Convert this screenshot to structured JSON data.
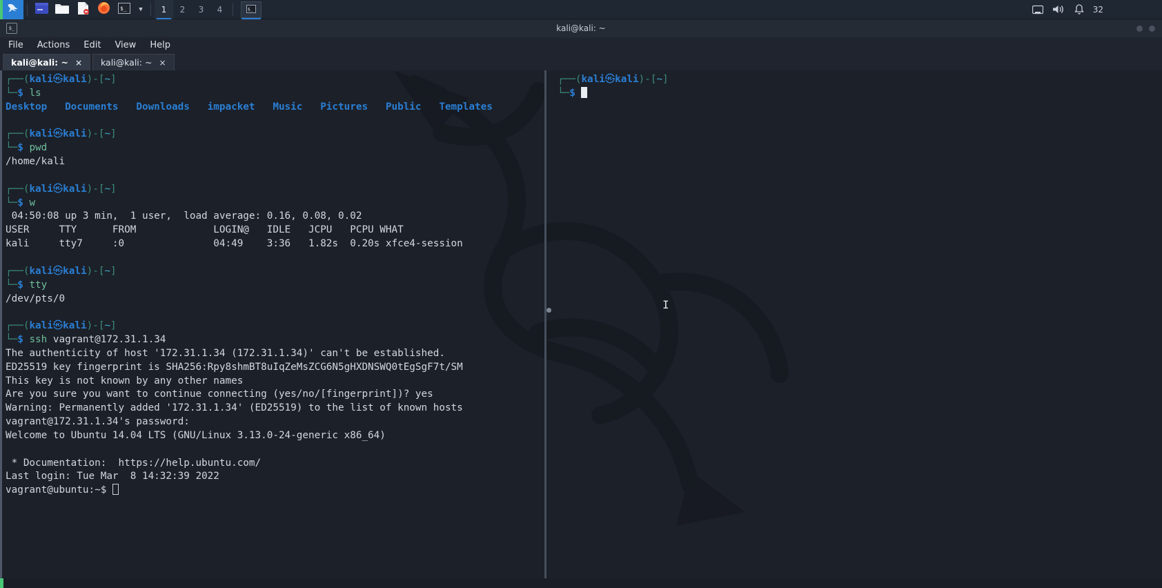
{
  "taskbar": {
    "kali_logo_icon": "kali-dragon-icon",
    "launchers": [
      {
        "name": "terminal-emulator-launcher",
        "icon": "terminal-window-icon"
      },
      {
        "name": "file-manager-launcher",
        "icon": "folder-icon"
      },
      {
        "name": "text-editor-launcher",
        "icon": "document-icon"
      },
      {
        "name": "firefox-launcher",
        "icon": "firefox-icon"
      },
      {
        "name": "terminal-launcher",
        "icon": "terminal-prompt-icon"
      }
    ],
    "chevron_icon": "chevron-down-icon",
    "workspaces": [
      {
        "label": "1",
        "active": true
      },
      {
        "label": "2",
        "active": false
      },
      {
        "label": "3",
        "active": false
      },
      {
        "label": "4",
        "active": false
      }
    ],
    "window_button_icon": "terminal-prompt-icon",
    "tray": [
      {
        "name": "network-icon",
        "glyph": "▣"
      },
      {
        "name": "volume-icon",
        "glyph": "🔊"
      },
      {
        "name": "notification-bell-icon",
        "glyph": "🔔"
      }
    ],
    "clock": "32"
  },
  "window": {
    "title": "kali@kali: ~",
    "icon": "terminal-window-icon",
    "menu": [
      "File",
      "Actions",
      "Edit",
      "View",
      "Help"
    ],
    "tabs": [
      {
        "label": "kali@kali: ~",
        "close": "×",
        "active": true
      },
      {
        "label": "kali@kali: ~",
        "close": "×",
        "active": false
      }
    ]
  },
  "terminal": {
    "prompt": {
      "top_left": "┌──(",
      "user": "kali",
      "at": "㉿",
      "host": "kali",
      "close_paren": ")-[",
      "path": "~",
      "close_bracket": "]",
      "bottom_left": "└─",
      "dollar": "$"
    },
    "left_pane": {
      "blocks": [
        {
          "command": "ls",
          "output": [
            {
              "text": "Desktop   Documents   Downloads   impacket   Music   Pictures   Public   Templates",
              "class": "c-dir"
            }
          ]
        },
        {
          "command": "pwd",
          "output": [
            {
              "text": "/home/kali",
              "class": "c-out"
            }
          ]
        },
        {
          "command": "w",
          "output": [
            {
              "text": " 04:50:08 up 3 min,  1 user,  load average: 0.16, 0.08, 0.02",
              "class": "c-out"
            },
            {
              "text": "USER     TTY      FROM             LOGIN@   IDLE   JCPU   PCPU WHAT",
              "class": "c-out"
            },
            {
              "text": "kali     tty7     :0               04:49    3:36   1.82s  0.20s xfce4-session",
              "class": "c-out"
            }
          ]
        },
        {
          "command": "tty",
          "output": [
            {
              "text": "/dev/pts/0",
              "class": "c-out"
            }
          ]
        },
        {
          "command": "ssh",
          "command_arg": " vagrant@172.31.1.34",
          "output": [
            {
              "text": "The authenticity of host '172.31.1.34 (172.31.1.34)' can't be established.",
              "class": "c-out"
            },
            {
              "text": "ED25519 key fingerprint is SHA256:Rpy8shmBT8uIqZeMsZCG6N5gHXDNSWQ0tEgSgF7t/SM",
              "class": "c-out"
            },
            {
              "text": "This key is not known by any other names",
              "class": "c-out"
            },
            {
              "text": "Are you sure you want to continue connecting (yes/no/[fingerprint])? yes",
              "class": "c-out"
            },
            {
              "text": "Warning: Permanently added '172.31.1.34' (ED25519) to the list of known hosts",
              "class": "c-out"
            },
            {
              "text": "vagrant@172.31.1.34's password:",
              "class": "c-out"
            },
            {
              "text": "Welcome to Ubuntu 14.04 LTS (GNU/Linux 3.13.0-24-generic x86_64)",
              "class": "c-out"
            },
            {
              "text": "",
              "class": "c-out"
            },
            {
              "text": " * Documentation:  https://help.ubuntu.com/",
              "class": "c-out"
            },
            {
              "text": "Last login: Tue Mar  8 14:32:39 2022",
              "class": "c-out"
            }
          ]
        }
      ],
      "remote_prompt": "vagrant@ubuntu:~$ "
    },
    "right_pane": {
      "command": ""
    }
  }
}
